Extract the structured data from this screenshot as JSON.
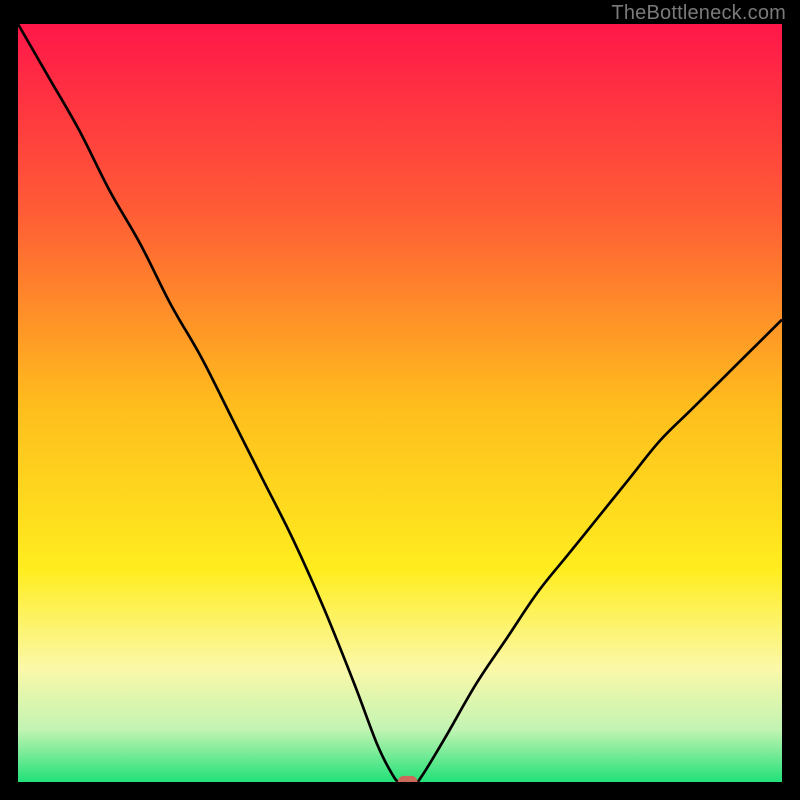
{
  "watermark": "TheBottleneck.com",
  "chart_data": {
    "type": "line",
    "title": "",
    "xlabel": "",
    "ylabel": "",
    "xlim": [
      0,
      100
    ],
    "ylim": [
      0,
      100
    ],
    "background": {
      "type": "vertical-gradient",
      "stops": [
        {
          "offset": 0,
          "color": "#ff1749"
        },
        {
          "offset": 25,
          "color": "#ff5d35"
        },
        {
          "offset": 50,
          "color": "#ffbc1d"
        },
        {
          "offset": 72,
          "color": "#ffed1f"
        },
        {
          "offset": 85,
          "color": "#fbf8a8"
        },
        {
          "offset": 93,
          "color": "#c3f4b3"
        },
        {
          "offset": 100,
          "color": "#22e178"
        }
      ]
    },
    "series": [
      {
        "name": "curve",
        "color": "#000000",
        "x": [
          0,
          4,
          8,
          12,
          16,
          20,
          24,
          28,
          32,
          36,
          40,
          44,
          47,
          49,
          50,
          52,
          53,
          56,
          60,
          64,
          68,
          72,
          76,
          80,
          84,
          88,
          92,
          96,
          100
        ],
        "y": [
          100,
          93,
          86,
          78,
          71,
          63,
          56,
          48,
          40,
          32,
          23,
          13,
          5,
          1,
          0,
          0,
          1,
          6,
          13,
          19,
          25,
          30,
          35,
          40,
          45,
          49,
          53,
          57,
          61
        ]
      }
    ],
    "marker": {
      "name": "min-point",
      "x": 51,
      "y": 0,
      "color": "#c96a5a"
    }
  }
}
